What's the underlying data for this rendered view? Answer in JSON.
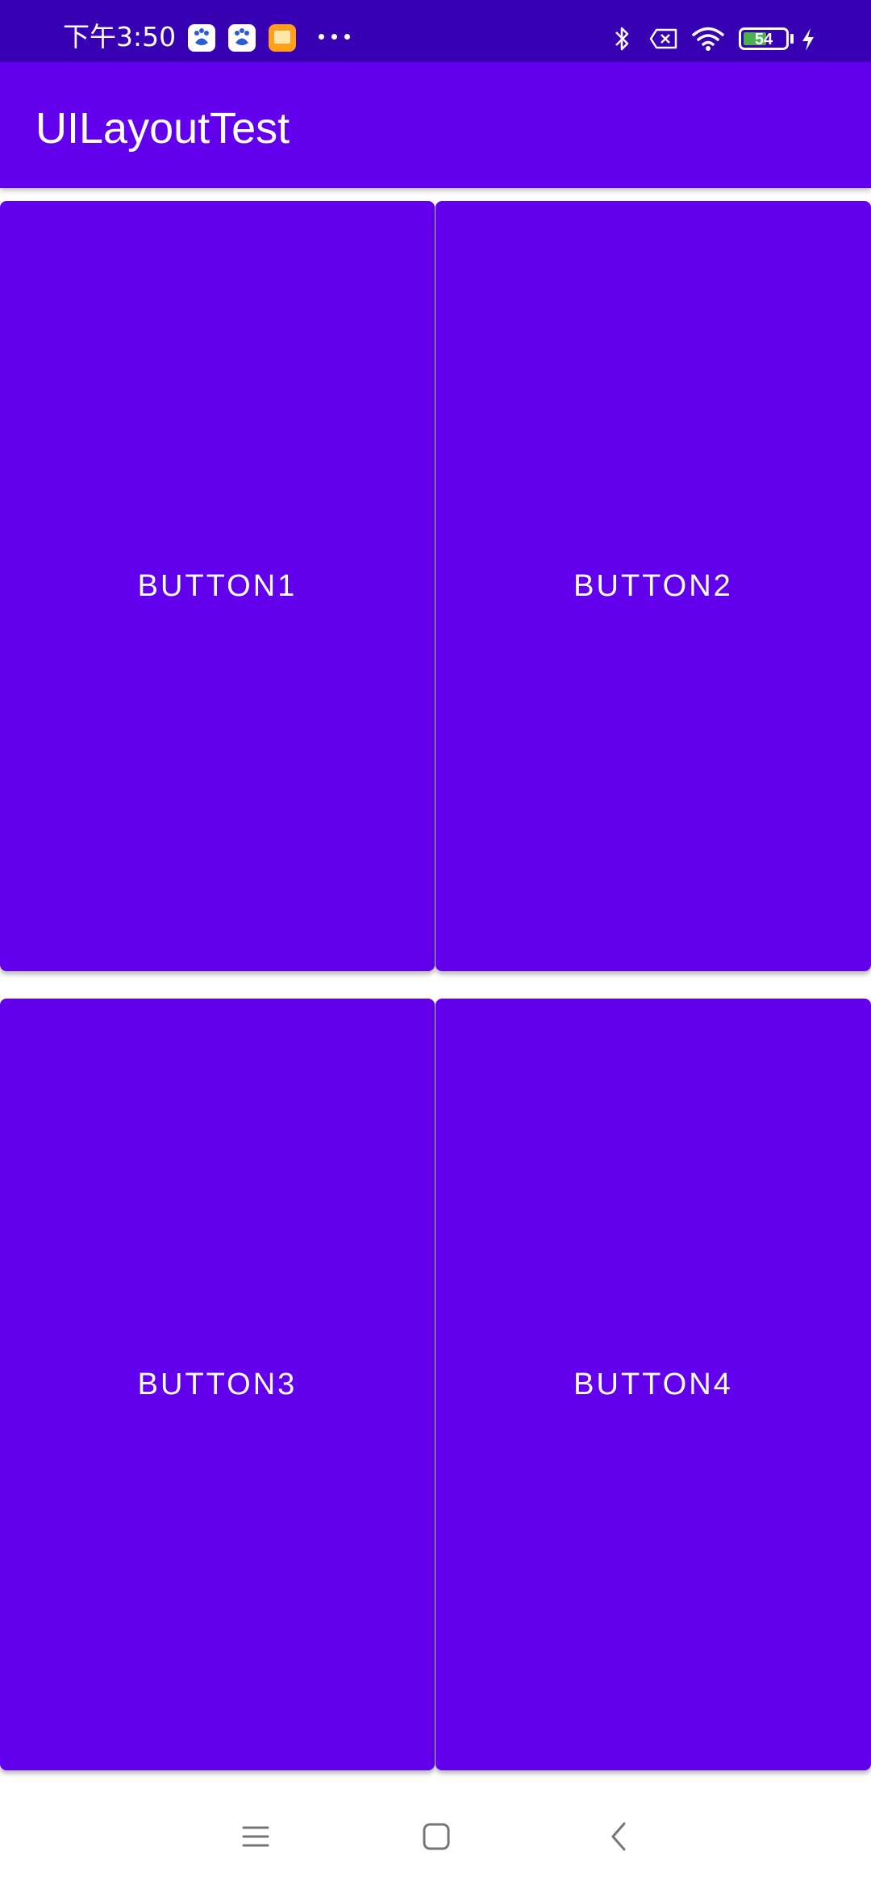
{
  "status_bar": {
    "time": "下午3:50",
    "battery_level": "54",
    "icons": [
      "baidu-app-icon",
      "baidu-app-icon",
      "books-app-icon",
      "more-dots-icon",
      "bluetooth-icon",
      "no-sim-icon",
      "wifi-icon",
      "battery-icon",
      "charging-icon"
    ]
  },
  "app_bar": {
    "title": "UILayoutTest"
  },
  "buttons": [
    {
      "label": "BUTTON1"
    },
    {
      "label": "BUTTON2"
    },
    {
      "label": "BUTTON3"
    },
    {
      "label": "BUTTON4"
    }
  ],
  "nav_bar": {
    "icons": [
      "menu-icon",
      "home-icon",
      "back-icon"
    ]
  },
  "colors": {
    "status_bar": "#3700b3",
    "primary": "#6200ee",
    "on_primary": "#ffffff",
    "background": "#ffffff"
  }
}
